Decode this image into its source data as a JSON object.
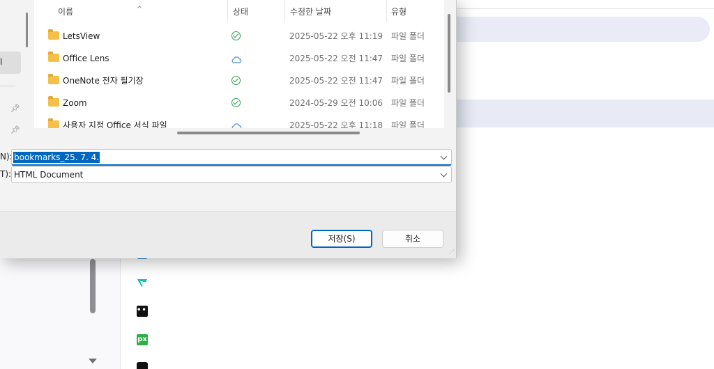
{
  "list": {
    "columns": {
      "name": "이름",
      "status": "상태",
      "date": "수정한 날짜",
      "type": "유형"
    },
    "rows": [
      {
        "name": "LetsView",
        "status": "synced",
        "date": "2025-05-22 오후 11:19",
        "type": "파일 폴더"
      },
      {
        "name": "Office Lens",
        "status": "cloud",
        "date": "2025-05-22 오전 11:47",
        "type": "파일 폴더"
      },
      {
        "name": "OneNote 전자 필기장",
        "status": "synced",
        "date": "2025-05-22 오전 11:47",
        "type": "파일 폴더"
      },
      {
        "name": "Zoom",
        "status": "synced",
        "date": "2024-05-29 오전 10:06",
        "type": "파일 폴더"
      },
      {
        "name": "사용자 지정 Office 서식 파일",
        "status": "cloud",
        "date": "2025-05-22 오후 11:18",
        "type": "파일 폴더"
      }
    ]
  },
  "nav": {
    "selected_label": "l"
  },
  "fields": {
    "filename_label": "N):",
    "filename_value": "bookmarks_25. 7. 4.",
    "filetype_label": "T):",
    "filetype_value": "HTML Document"
  },
  "buttons": {
    "save": "저장(S)",
    "cancel": "취소"
  },
  "icons": {
    "folder": "folder-icon",
    "synced": "check-circle-icon",
    "cloud": "cloud-icon",
    "pin": "pin-icon",
    "dropdown": "chevron-down-icon"
  },
  "background_icons": {
    "dots": "•••",
    "px": "px"
  },
  "colors": {
    "accent": "#0067c0",
    "synced": "#2a9d4a",
    "cloud": "#4a8fd6",
    "folder": "#f5c04a"
  }
}
